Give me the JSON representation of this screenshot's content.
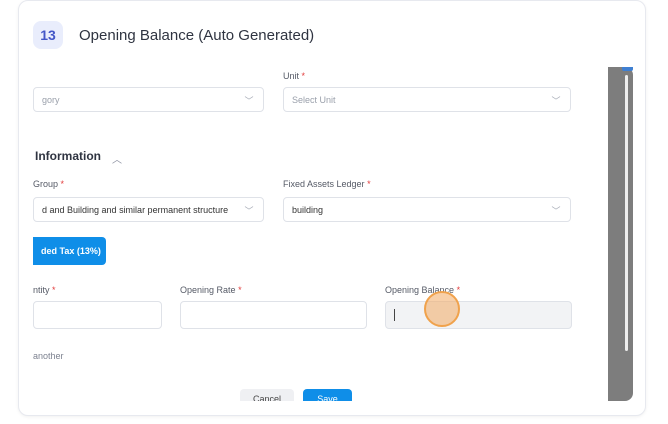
{
  "step": {
    "number": "13",
    "title": "Opening Balance (Auto Generated)"
  },
  "form": {
    "unit_label": "Unit",
    "category_placeholder": "gory",
    "unit_placeholder": "Select Unit",
    "section_title": "Information",
    "group_label": "Group",
    "group_value": "d and Building and similar permanent structure",
    "ledger_label": "Fixed Assets Ledger",
    "ledger_value": "building",
    "tax_button": "ded Tax (13%)",
    "quantity_label": "ntity",
    "opening_rate_label": "Opening Rate",
    "opening_balance_label": "Opening Balance",
    "add_another": "another",
    "required_mark": "*",
    "cancel_label": "Cancel",
    "save_label": "Save"
  },
  "colors": {
    "accent": "#0f8ee8",
    "required": "#e23b3b",
    "highlight": "#f3aa62"
  }
}
